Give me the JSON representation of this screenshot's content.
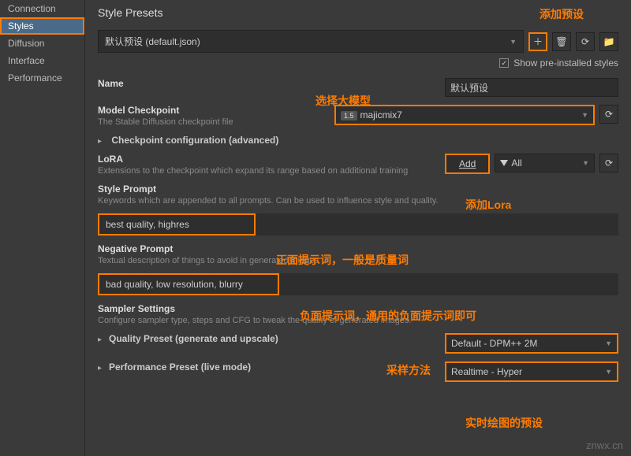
{
  "sidebar": {
    "items": [
      {
        "label": "Connection"
      },
      {
        "label": "Styles"
      },
      {
        "label": "Diffusion"
      },
      {
        "label": "Interface"
      },
      {
        "label": "Performance"
      }
    ]
  },
  "header": {
    "title": "Style Presets"
  },
  "preset": {
    "selected": "默认预设 (default.json)",
    "show_preinstalled": "Show pre-installed styles"
  },
  "name": {
    "label": "Name",
    "value": "默认预设"
  },
  "model": {
    "label": "Model Checkpoint",
    "sub": "The Stable Diffusion checkpoint file",
    "value": "majicmix7",
    "badge": "1.5",
    "advanced": "Checkpoint configuration (advanced)"
  },
  "lora": {
    "label": "LoRA",
    "sub": "Extensions to the checkpoint which expand its range based on additional training",
    "add": "Add",
    "filter": "All"
  },
  "styleprompt": {
    "label": "Style Prompt",
    "sub": "Keywords which are appended to all prompts. Can be used to influence style and quality.",
    "value": "best quality, highres"
  },
  "negprompt": {
    "label": "Negative Prompt",
    "sub": "Textual description of things to avoid in generated images",
    "value": "bad quality, low resolution, blurry"
  },
  "sampler": {
    "label": "Sampler Settings",
    "sub": "Configure sampler type, steps and CFG to tweak the quality of generated images.",
    "quality_label": "Quality Preset (generate and upscale)",
    "quality_value": "Default - DPM++ 2M",
    "perf_label": "Performance Preset (live mode)",
    "perf_value": "Realtime - Hyper"
  },
  "annotations": {
    "add_preset": "添加预设",
    "choose_model": "选择大模型",
    "add_lora": "添加Lora",
    "pos_prompt": "正面提示词，一般是质量词",
    "neg_prompt": "负面提示词，通用的负面提示词即可",
    "sampler_method": "采样方法",
    "live_preset": "实时绘图的预设"
  },
  "watermark": "znwx.cn"
}
